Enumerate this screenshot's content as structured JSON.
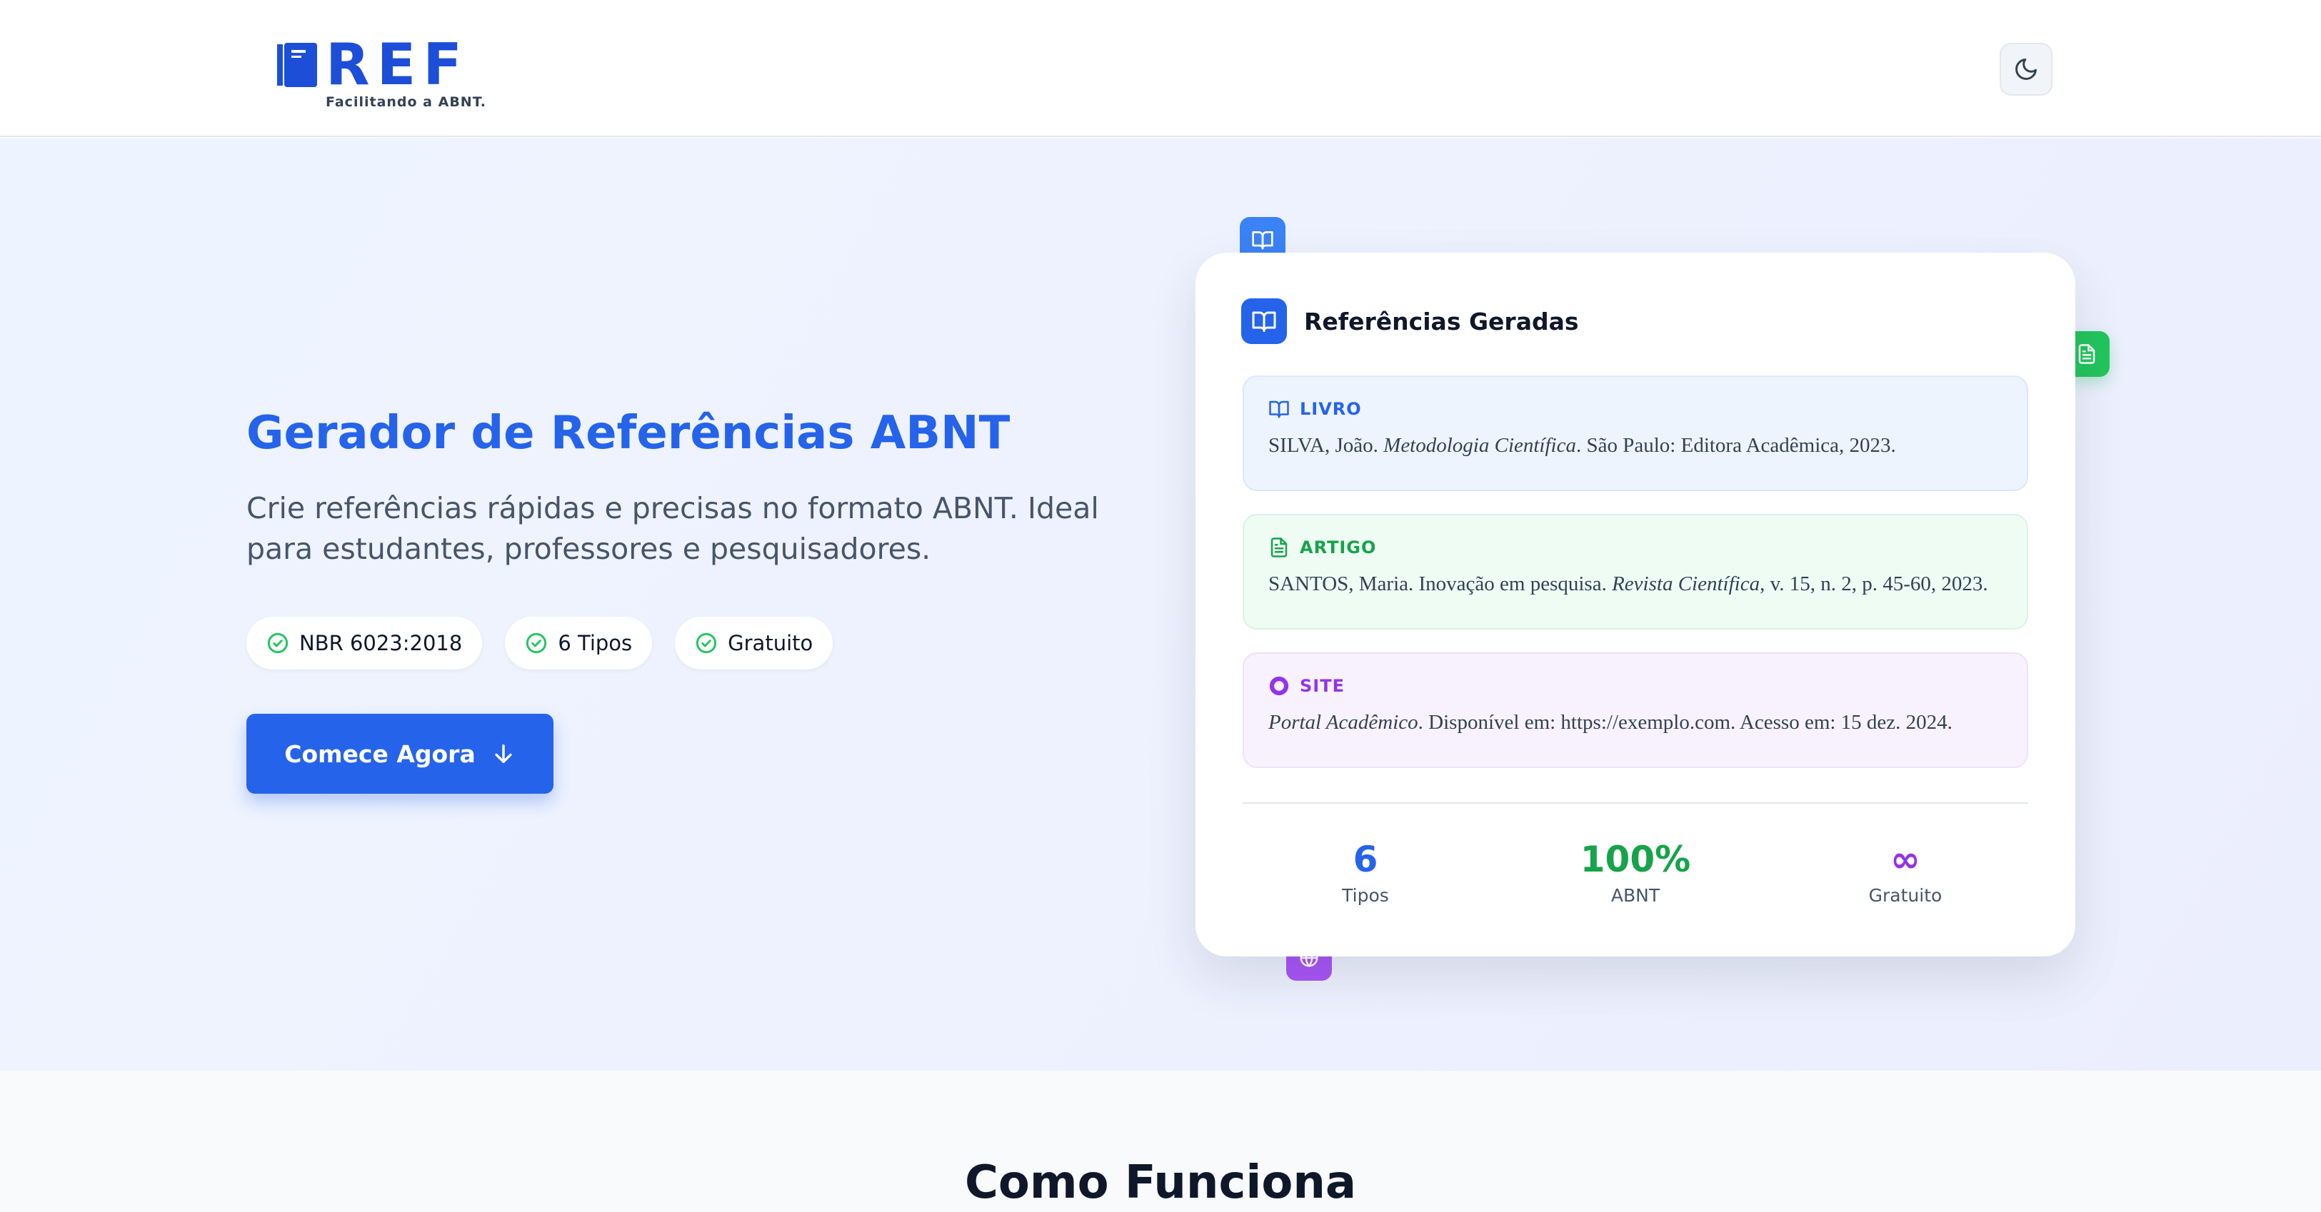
{
  "header": {
    "logo_text": "REF",
    "tagline": "Facilitando a ABNT.",
    "theme_icon": "moon-icon"
  },
  "hero": {
    "title": "Gerador de Referências ABNT",
    "subtitle": "Crie referências rápidas e precisas no formato ABNT. Ideal para estudantes, professores e pesquisadores.",
    "pills": [
      {
        "label": "NBR 6023:2018",
        "icon": "check-circle-icon"
      },
      {
        "label": "6 Tipos",
        "icon": "check-circle-icon"
      },
      {
        "label": "Gratuito",
        "icon": "check-circle-icon"
      }
    ],
    "cta_label": "Comece Agora",
    "cta_icon": "arrow-down-icon"
  },
  "card": {
    "title": "Referências Geradas",
    "title_icon": "book-open-icon",
    "references": [
      {
        "type": "LIVRO",
        "icon": "book-open-icon",
        "pre": "SILVA, João. ",
        "italic": "Metodologia Científica",
        "post": ". São Paulo: Editora Acadêmica, 2023."
      },
      {
        "type": "ARTIGO",
        "icon": "file-text-icon",
        "pre": "SANTOS, Maria. Inovação em pesquisa. ",
        "italic": "Revista Científica",
        "post": ", v. 15, n. 2, p. 45-60, 2023."
      },
      {
        "type": "SITE",
        "icon": "globe-icon",
        "pre": "",
        "italic": "Portal Acadêmico",
        "post": ". Disponível em: https://exemplo.com. Acesso em: 15 dez. 2024."
      }
    ],
    "stats": [
      {
        "value": "6",
        "label": "Tipos"
      },
      {
        "value": "100%",
        "label": "ABNT"
      },
      {
        "value": "∞",
        "label": "Gratuito"
      }
    ]
  },
  "colors": {
    "primary": "#2563eb",
    "green": "#16a34a",
    "purple": "#9333ea"
  },
  "section": {
    "title": "Como Funciona"
  }
}
